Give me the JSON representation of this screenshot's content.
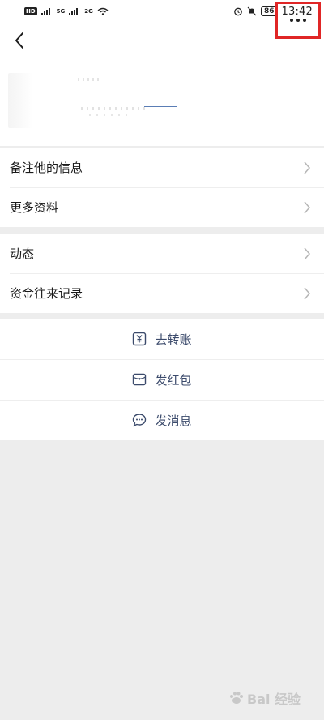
{
  "status_bar": {
    "left_badges": [
      "HD",
      "5G",
      "2G"
    ],
    "battery": "86",
    "time": "13:42"
  },
  "header": {
    "back_icon": "chevron-left-icon",
    "more_icon": "more-dots-icon",
    "highlight_color": "#e02626"
  },
  "info_rows": [
    {
      "label": "备注他的信息"
    },
    {
      "label": "更多资料"
    }
  ],
  "activity_rows": [
    {
      "label": "动态"
    },
    {
      "label": "资金往来记录"
    }
  ],
  "actions": [
    {
      "label": "去转账",
      "icon": "yuan-transfer-icon"
    },
    {
      "label": "发红包",
      "icon": "red-packet-icon"
    },
    {
      "label": "发消息",
      "icon": "chat-bubble-icon"
    }
  ],
  "watermark": {
    "text": "Bai 经验"
  },
  "colors": {
    "background": "#ededed",
    "card": "#ffffff",
    "action_text": "#3b4a6b"
  }
}
